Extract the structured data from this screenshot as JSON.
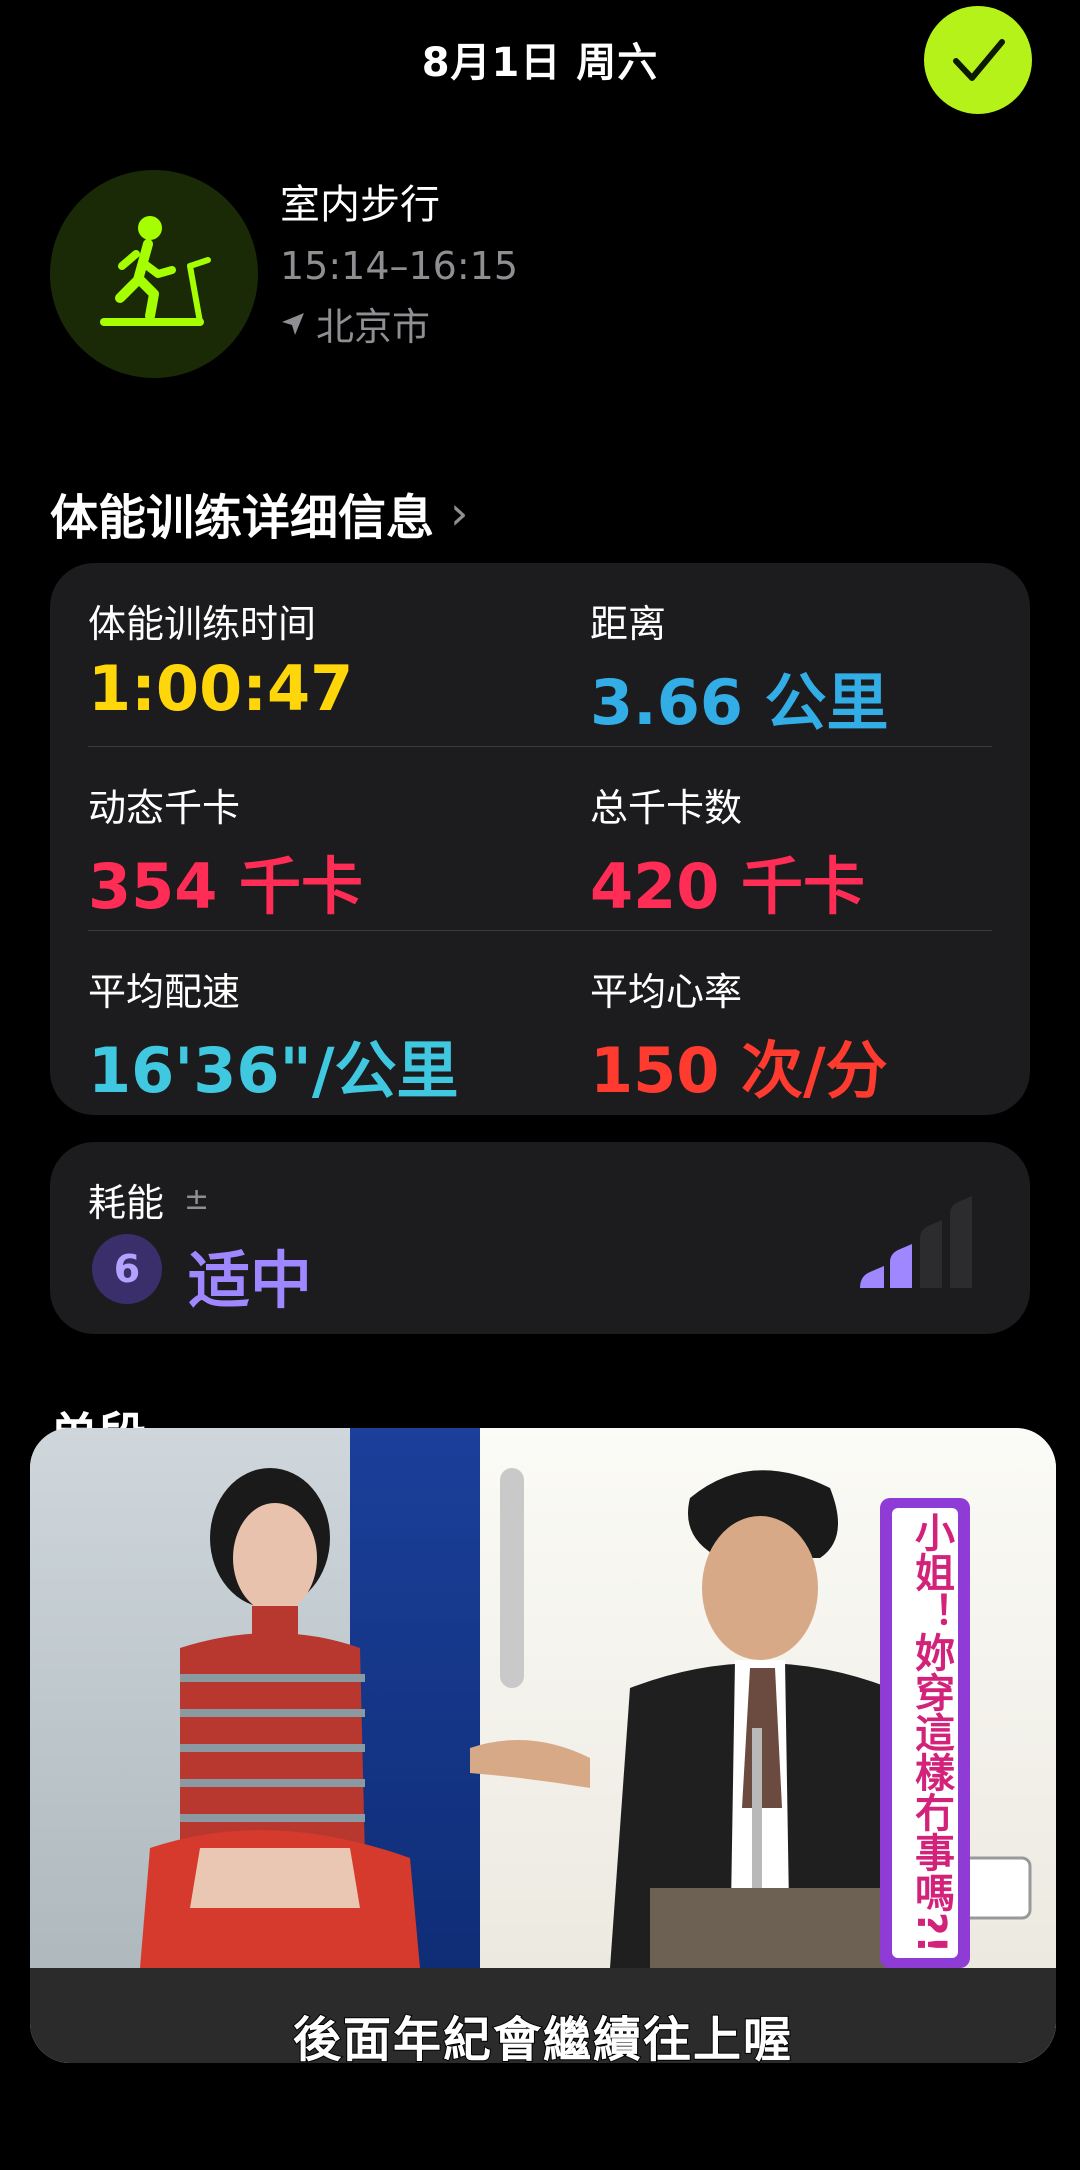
{
  "header": {
    "date": "8月1日 周六"
  },
  "workout": {
    "title": "室内步行",
    "time_range": "15:14–16:15",
    "location": "北京市"
  },
  "details": {
    "section_title": "体能训练详细信息",
    "items": [
      {
        "label": "体能训练时间",
        "value": "1:00:47",
        "color": "#ffd60a"
      },
      {
        "label": "距离",
        "value": "3.66 公里",
        "color": "#32ade6"
      },
      {
        "label": "动态千卡",
        "value": "354 千卡",
        "color": "#ff2d55"
      },
      {
        "label": "总千卡数",
        "value": "420 千卡",
        "color": "#ff2d55"
      },
      {
        "label": "平均配速",
        "value": "16'36\"/公里",
        "color": "#40c8e0"
      },
      {
        "label": "平均心率",
        "value": "150 次/分",
        "color": "#ff3b30"
      }
    ]
  },
  "effort": {
    "label": "耗能",
    "plusminus": "±",
    "score": "6",
    "level": "适中",
    "bars_filled": 2,
    "bars_total": 4
  },
  "splits": {
    "title": "单段"
  },
  "video": {
    "caption": "後面年紀會繼續往上喔",
    "side_text": "小姐！妳穿這樣冇事嗎?!"
  },
  "colors": {
    "accent": "#b5f219",
    "effort": "#9f87ff"
  }
}
